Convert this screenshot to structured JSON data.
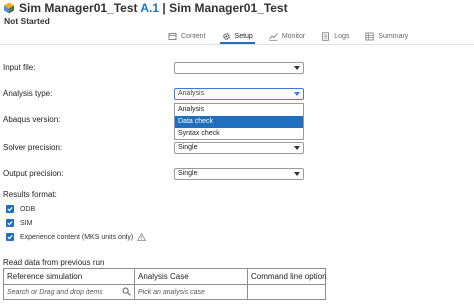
{
  "header": {
    "title_prefix": "Sim Manager01_Test ",
    "revision": "A.1",
    "title_suffix": " | Sim Manager01_Test",
    "status": "Not Started"
  },
  "tabs": [
    {
      "label": "Content",
      "icon": "content-icon",
      "active": false
    },
    {
      "label": "Setup",
      "icon": "gear-icon",
      "active": true
    },
    {
      "label": "Monitor",
      "icon": "monitor-icon",
      "active": false
    },
    {
      "label": "Logs",
      "icon": "logs-icon",
      "active": false
    },
    {
      "label": "Summary",
      "icon": "summary-icon",
      "active": false
    }
  ],
  "form": {
    "input_file_label": "Input file:",
    "input_file_value": "",
    "analysis_type_label": "Analysis type:",
    "analysis_type_value": "Analysis",
    "analysis_type_options": [
      "Analysis",
      "Data check",
      "Syntax check"
    ],
    "analysis_type_highlighted": "Data check",
    "abaqus_version_label": "Abaqus version:",
    "solver_precision_label": "Solver precision:",
    "solver_precision_value": "Single",
    "output_precision_label": "Output precision:",
    "output_precision_value": "Single",
    "results_format_label": "Results format:",
    "results_formats": [
      {
        "label": "ODB",
        "checked": true
      },
      {
        "label": "SIM",
        "checked": true
      },
      {
        "label": "Experience content (MKS units only)",
        "checked": true
      }
    ]
  },
  "previous_run": {
    "label": "Read data from previous run",
    "columns": [
      "Reference simulation",
      "Analysis Case",
      "Command line option"
    ],
    "placeholders": [
      "Search or Drag and drop items",
      "Pick an analysis case",
      ""
    ]
  },
  "colors": {
    "accent": "#1f6fbd",
    "revision": "#1a73c9"
  }
}
